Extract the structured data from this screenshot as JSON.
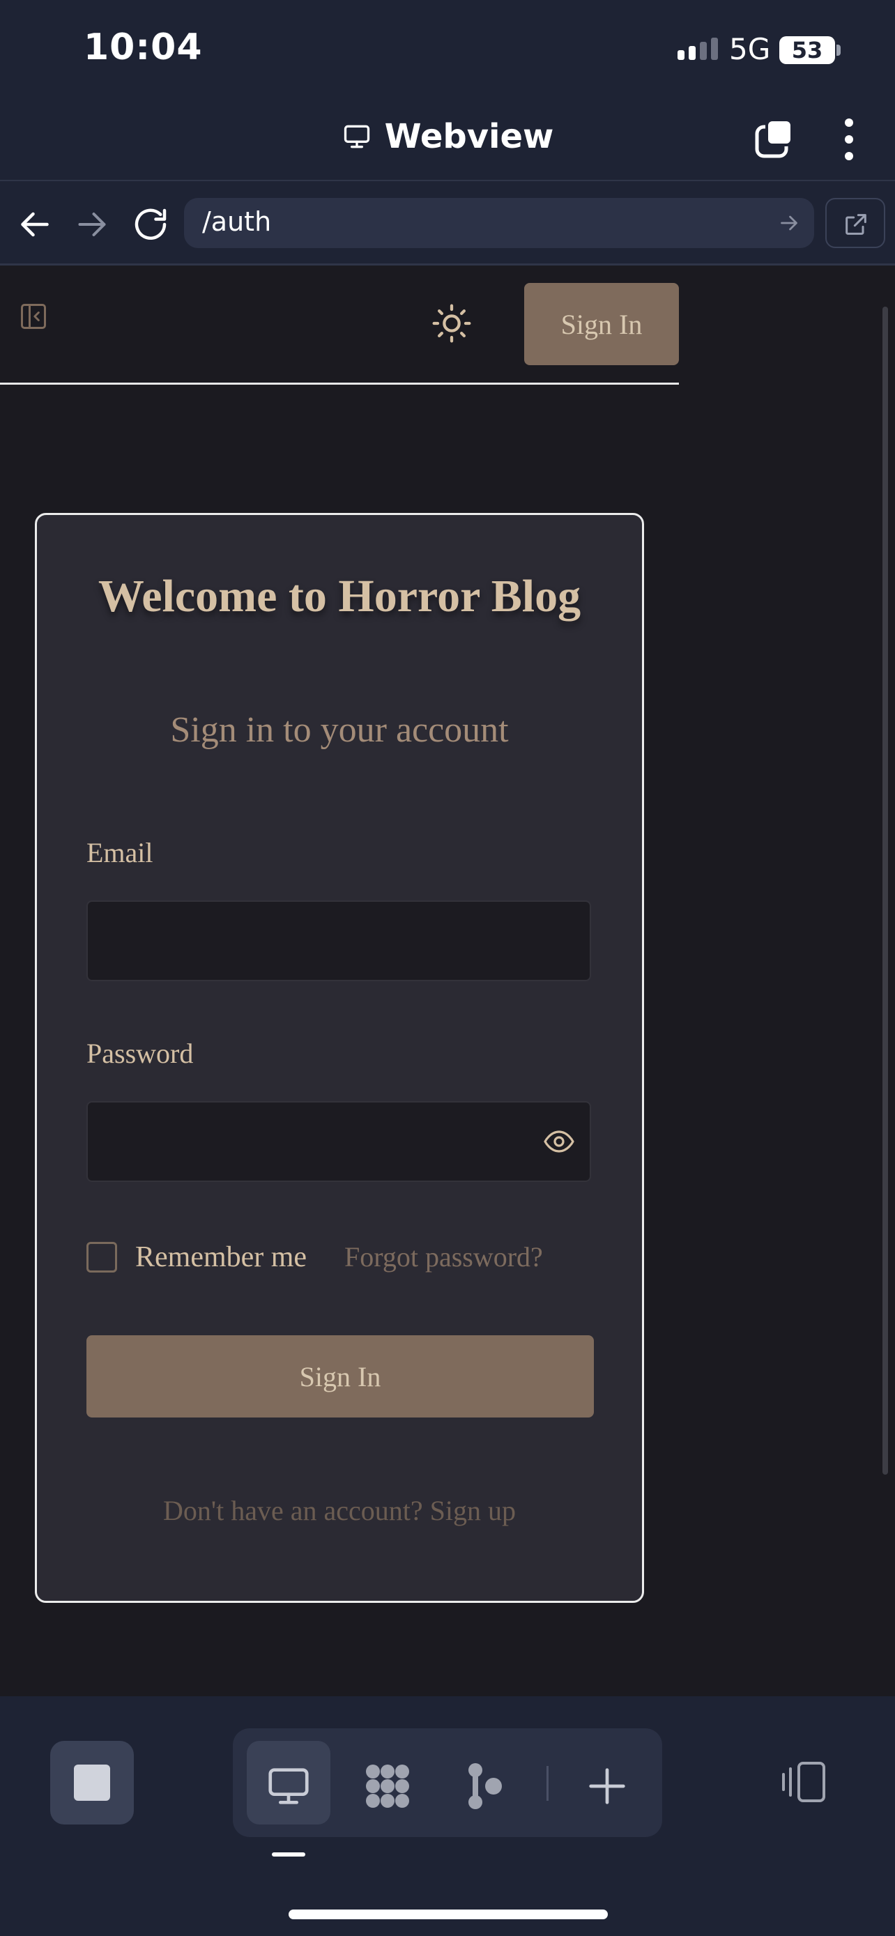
{
  "status_bar": {
    "time": "10:04",
    "network": "5G",
    "battery": "53"
  },
  "header": {
    "title": "Webview"
  },
  "address_bar": {
    "url": "/auth"
  },
  "site_nav": {
    "signin_label": "Sign In"
  },
  "auth_card": {
    "title": "Welcome to Horror Blog",
    "subtitle": "Sign in to your account",
    "email_label": "Email",
    "email_value": "",
    "password_label": "Password",
    "password_value": "",
    "remember_label": "Remember me",
    "forgot_label": "Forgot password?",
    "submit_label": "Sign In",
    "signup_prompt": "Don't have an account? Sign up"
  },
  "colors": {
    "chrome_bg": "#1e2334",
    "page_bg": "#1b1a20",
    "card_bg": "#2b2a33",
    "accent_button": "#7f6b5c",
    "title_text": "#d5c0a4",
    "muted_text": "#7d6b5e"
  },
  "icons": {
    "header": [
      "monitor-icon",
      "tabs-icon",
      "more-vertical-icon"
    ],
    "address": [
      "back-arrow-icon",
      "forward-arrow-icon",
      "reload-icon",
      "go-arrow-icon",
      "external-link-icon"
    ],
    "page": [
      "sidebar-toggle-icon",
      "sun-icon",
      "eye-icon"
    ],
    "toolbar": [
      "stop-icon",
      "monitor-icon",
      "grid-dots-icon",
      "branch-icon",
      "plus-icon",
      "device-rotate-icon"
    ]
  }
}
